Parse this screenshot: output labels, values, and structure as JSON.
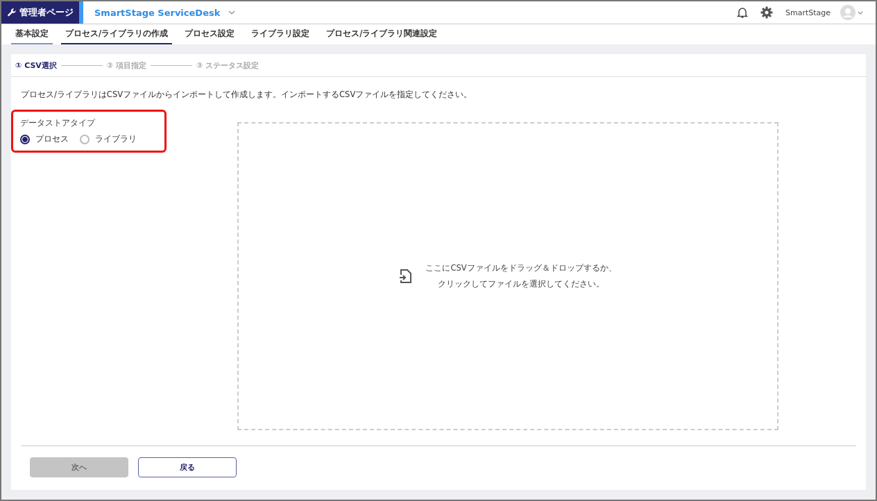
{
  "header": {
    "admin_label": "管理者ページ",
    "app_name": "SmartStage ServiceDesk",
    "user_name": "SmartStage"
  },
  "tabs": [
    {
      "label": "基本設定",
      "selected": false,
      "hovered": true
    },
    {
      "label": "プロセス/ライブラリの作成",
      "selected": true,
      "hovered": false
    },
    {
      "label": "プロセス設定",
      "selected": false,
      "hovered": false
    },
    {
      "label": "ライブラリ設定",
      "selected": false,
      "hovered": false
    },
    {
      "label": "プロセス/ライブラリ関連設定",
      "selected": false,
      "hovered": false
    }
  ],
  "steps": [
    {
      "label": "① CSV選択",
      "active": true
    },
    {
      "label": "② 項目指定",
      "active": false
    },
    {
      "label": "③ ステータス設定",
      "active": false
    }
  ],
  "instruction": "プロセス/ライブラリはCSVファイルからインポートして作成します。インポートするCSVファイルを指定してください。",
  "datastore_type": {
    "label": "データストアタイプ",
    "highlighted": true,
    "options": [
      {
        "label": "プロセス",
        "selected": true
      },
      {
        "label": "ライブラリ",
        "selected": false
      }
    ]
  },
  "drop_zone": {
    "lines": [
      "ここにCSVファイルをドラッグ＆ドロップするか、",
      "クリックしてファイルを選択してください。"
    ]
  },
  "buttons": [
    {
      "label": "次へ",
      "disabled": true
    },
    {
      "label": "戻る",
      "disabled": false
    }
  ]
}
